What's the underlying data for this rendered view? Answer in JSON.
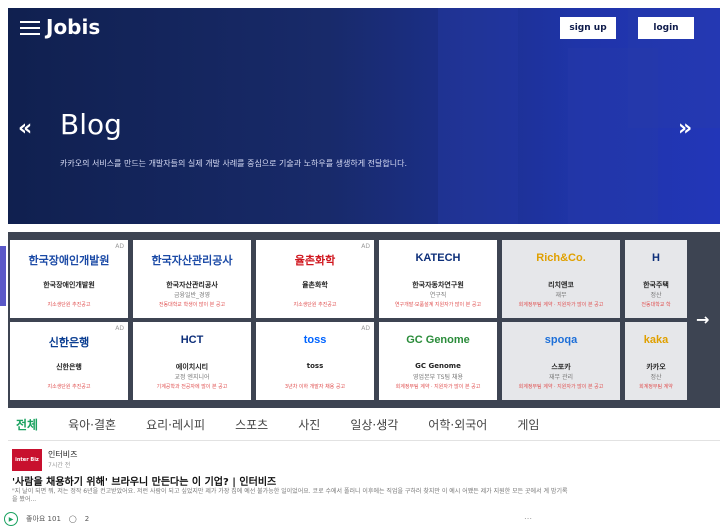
{
  "header": {
    "brand": "Jobis",
    "signup_label": "sign up",
    "login_label": "login"
  },
  "hero": {
    "title": "Blog",
    "description": "카카오의 서비스를 만드는 개발자들의 실제 개발 사례를 중심으로 기술과 노하우를 생생하게 전달합니다.",
    "prev_arrow": "«",
    "next_arrow": "»"
  },
  "companies": [
    {
      "logo": "한국장애인개발원",
      "name": "한국장애인개발원",
      "sub": "",
      "note": "지소생단원 추진공고",
      "ad": "AD",
      "logo_color": "#1b4aa6"
    },
    {
      "logo": "한국자산관리공사",
      "name": "한국자산관리공사",
      "sub": "금융일반_경영",
      "note": "전동대학교 학생이 많이 본 공고",
      "ad": "",
      "logo_color": "#1b4aa6"
    },
    {
      "logo": "율촌화학",
      "name": "율촌화학",
      "sub": "",
      "note": "지소생단원 추진공고",
      "ad": "AD",
      "logo_color": "#d0161e"
    },
    {
      "logo": "KATECH",
      "name": "한국자동차연구원",
      "sub": "연구직",
      "note": "연구개발·모품설계 지원자가 많이 본 공고",
      "ad": "",
      "logo_color": "#0d2f7a"
    },
    {
      "logo": "Rich&Co.",
      "name": "리치앤코",
      "sub": "재무",
      "note": "회계정무팀 계약 · 지원자가 많이 본 공고",
      "ad": "",
      "logo_color": "#e0a000"
    },
    {
      "logo": "H",
      "name": "한국주택",
      "sub": "정산",
      "note": "전동대학교 학",
      "ad": "",
      "logo_color": "#0d2f7a"
    },
    {
      "logo": "신한은행",
      "name": "신한은행",
      "sub": "",
      "note": "지소생단원 추진공고",
      "ad": "AD",
      "logo_color": "#0a3d91"
    },
    {
      "logo": "HCT",
      "name": "에이치시티",
      "sub": "교정 엔지니어",
      "note": "기계공학과 전공자에 많이 본 공고",
      "ad": "",
      "logo_color": "#0d2f7a"
    },
    {
      "logo": "toss",
      "name": "toss",
      "sub": "",
      "note": "3년차 이하 개발자 채용 공고",
      "ad": "AD",
      "logo_color": "#0064ff"
    },
    {
      "logo": "GC Genome",
      "name": "GC Genome",
      "sub": "영업본부 TS팀 채용",
      "note": "회계정무팀 계약 · 지원자가 많이 본 공고",
      "ad": "",
      "logo_color": "#2a8c3a"
    },
    {
      "logo": "spoqa",
      "name": "스포카",
      "sub": "재무 관리",
      "note": "회계정무팀 계약 · 지원자가 많이 본 공고",
      "ad": "",
      "logo_color": "#1d6fd8"
    },
    {
      "logo": "kaka",
      "name": "카카오",
      "sub": "정산",
      "note": "회계정무팀 계약",
      "ad": "",
      "logo_color": "#e0a000"
    }
  ],
  "strip_next": "→",
  "tabs": [
    "전체",
    "육아·결혼",
    "요리·레시피",
    "스포츠",
    "사진",
    "일상·생각",
    "어학·외국어",
    "게임"
  ],
  "post": {
    "avatar_text": "inter Biz",
    "source": "인터비즈",
    "date": "7시간 전",
    "title": "'사람을 채용하기 위해' 브라우니 만든다는 이 기업? | 인터비즈",
    "body": "\"지 날이 되면 뭐, 저는 정작 6년을 컨고받았어요. 저런 사람이 되고 싶었지만 제가 가장 집에 예선 불가능한 일이었어요. 코로 수에서 폴러니 이후에는 직업을 구하러 찾지만 이 예시 어쨌든 제가 지원한 모든 곳에서 계 밤기록을 봤어...",
    "likes": "좋아요 101",
    "comments": "2"
  }
}
